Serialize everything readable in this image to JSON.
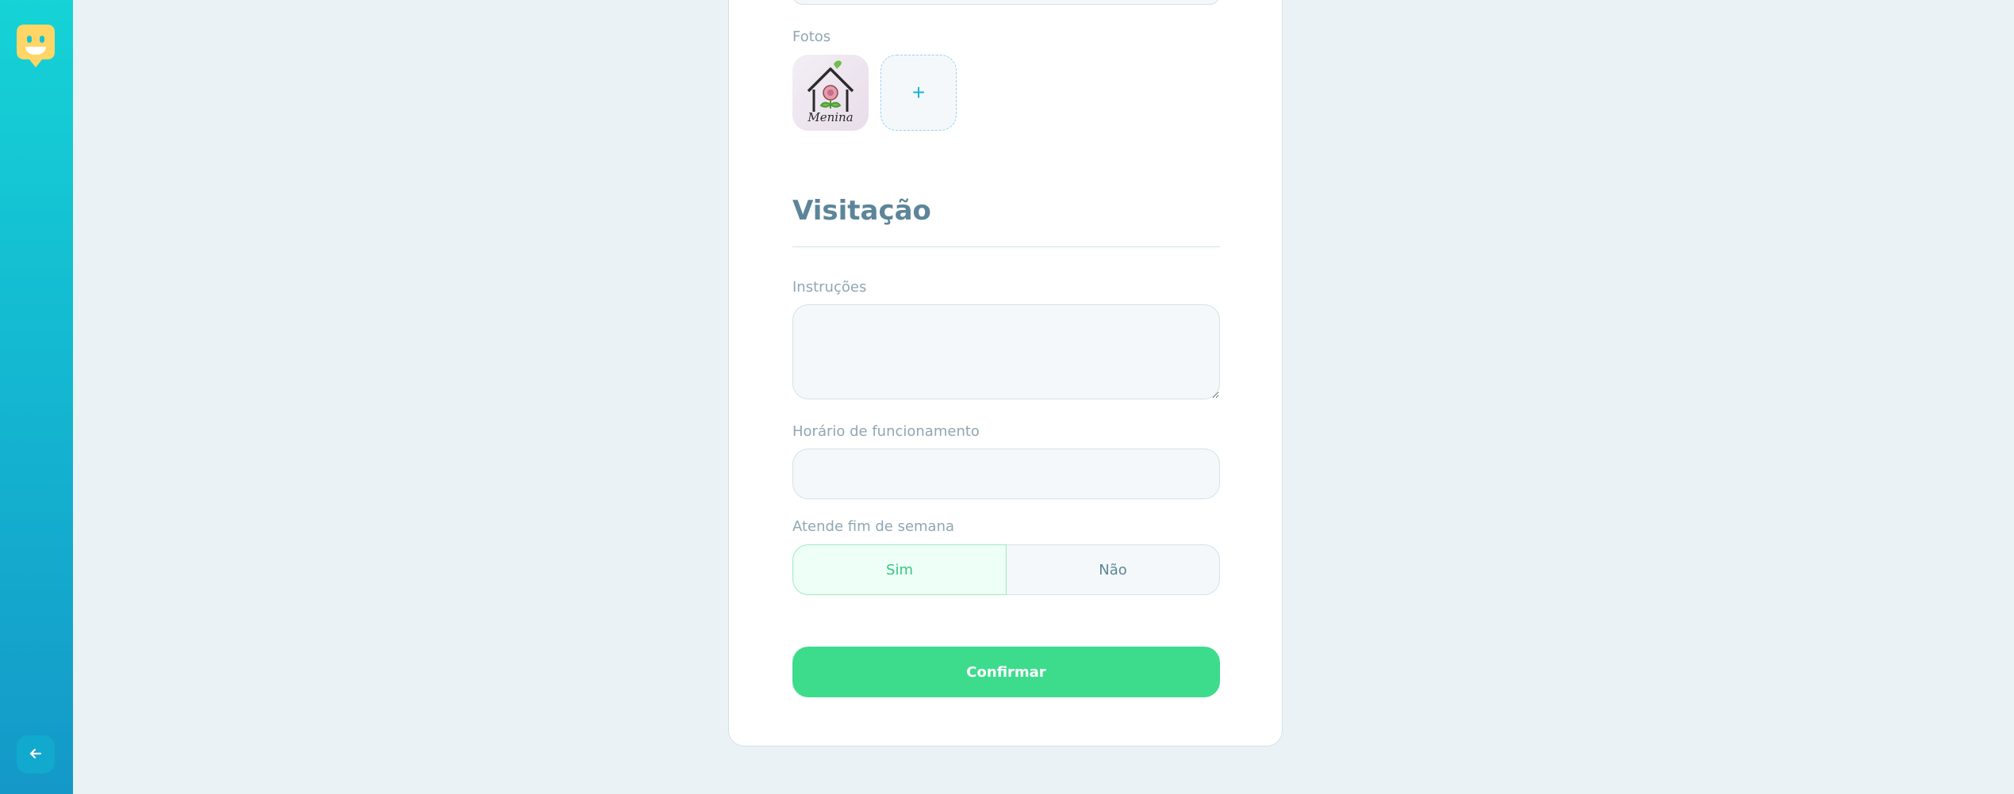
{
  "form": {
    "photos_label": "Fotos",
    "add_photo_symbol": "+",
    "photo_logo_text": "Menina",
    "visitation_title": "Visitação",
    "instructions_label": "Instruções",
    "instructions_value": "",
    "opening_hours_label": "Horário de funcionamento",
    "opening_hours_value": "",
    "weekend_label": "Atende fim de semana",
    "weekend_yes": "Sim",
    "weekend_no": "Não",
    "weekend_selected": "Sim",
    "confirm_label": "Confirmar"
  },
  "sidebar": {
    "logo_icon": "smiley-map-marker-icon",
    "back_icon": "arrow-left-icon"
  },
  "colors": {
    "sidebar_gradient_top": "#15d3d6",
    "sidebar_gradient_bottom": "#1498c8",
    "logo_yellow": "#ffd666",
    "confirm_green": "#3cdc8c",
    "selected_green": "#37c77f",
    "title_color": "#5c8599",
    "label_color": "#8fa7b3",
    "background": "#ebf2f5"
  }
}
